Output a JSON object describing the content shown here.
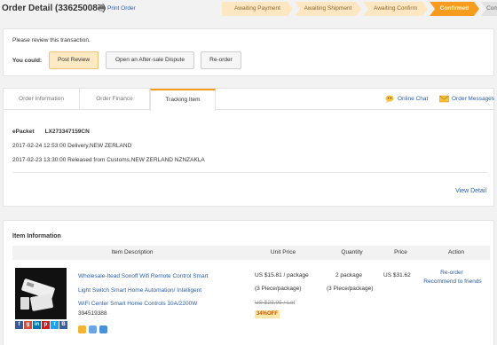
{
  "header": {
    "title": "Order Detail (336250087)",
    "print_label": "Print Order"
  },
  "steps": [
    {
      "label": "Awaiting Payment",
      "state": "done"
    },
    {
      "label": "Awaiting Shipment",
      "state": "done"
    },
    {
      "label": "Awaiting Confirm",
      "state": "done"
    },
    {
      "label": "Confirmed",
      "state": "active"
    },
    {
      "label": "Complete",
      "state": "future"
    }
  ],
  "actions": {
    "prompt": "Please review this transaction.",
    "you_could": "You could:",
    "post_review": "Post Review",
    "open_dispute": "Open an After-sale Dispute",
    "reorder": "Re-order"
  },
  "tabs": {
    "order_information": "Order Information",
    "order_finance": "Order Finance",
    "tracking_item": "Tracking Item",
    "active": "Tracking Item"
  },
  "tools": {
    "online_chat": "Online Chat",
    "order_messages": "Order Messages"
  },
  "tracking": {
    "carrier": "ePacket",
    "number": "LX273347159CN",
    "events": [
      "2017-02-24 12:53:00 Delivery,NEW ZERLAND",
      "2017-02-23 13:30:00 Released from Customs,NEW ZERLAND NZNZAKLA"
    ],
    "view_detail": "View Detail"
  },
  "items": {
    "title": "Item Information",
    "columns": [
      "Item Description",
      "Unit Price",
      "Quantity",
      "Price",
      "Action"
    ],
    "rows": [
      {
        "description_lines": [
          "Wholesale-Itead Sonoff Wifi Remote Control Smart",
          "Light Switch Smart Home Automation/ Intelligent",
          "WiFi Center Smart Home Controls 10A/2200W"
        ],
        "sku": "394519388",
        "unit_price": "US $15.81 / package",
        "unit_pack": "(3 Piece/package)",
        "original_price": "US $23.95 / Lot",
        "discount": "34%OFF",
        "quantity": "2 package",
        "quantity_pack": "(3 Piece/package)",
        "price": "US $31.62",
        "action_reorder": "Re-order",
        "action_recommend": "Recommend to friends"
      }
    ]
  },
  "colors": {
    "accent": "#f79c1e",
    "step_done": "#fde7c2",
    "link": "#2a5da8"
  }
}
